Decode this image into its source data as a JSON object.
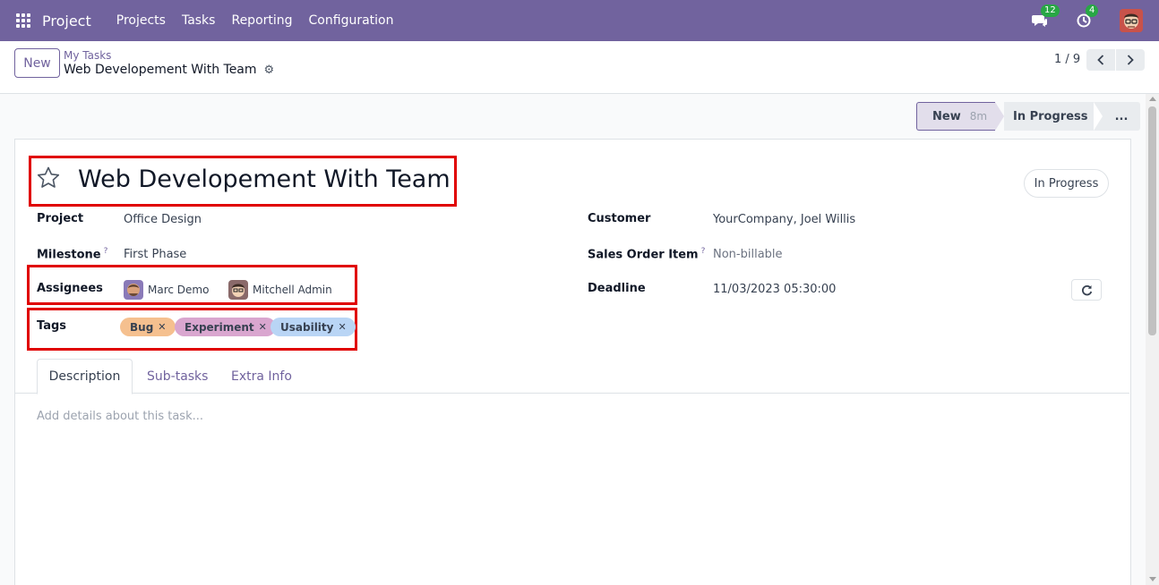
{
  "navbar": {
    "app_name": "Project",
    "menu": [
      "Projects",
      "Tasks",
      "Reporting",
      "Configuration"
    ],
    "messages_count": "12",
    "activities_count": "4",
    "bg_color": "#71639e"
  },
  "control_panel": {
    "new_label": "New",
    "breadcrumb_parent": "My Tasks",
    "breadcrumb_current": "Web Developement With Team",
    "pager": "1 / 9"
  },
  "statusbar": {
    "stage_new": "New",
    "stage_new_duration": "8m",
    "stage_in_progress": "In Progress",
    "more": "..."
  },
  "task": {
    "title": "Web Developement With Team",
    "state": "In Progress",
    "fields": {
      "project_label": "Project",
      "project_value": "Office Design",
      "milestone_label": "Milestone",
      "milestone_value": "First Phase",
      "assignees_label": "Assignees",
      "assignees": [
        "Marc Demo",
        "Mitchell Admin"
      ],
      "tags_label": "Tags",
      "tags": [
        {
          "label": "Bug",
          "color": "#f5c08f"
        },
        {
          "label": "Experiment",
          "color": "#d9a6cf"
        },
        {
          "label": "Usability",
          "color": "#b9d5f5"
        }
      ],
      "customer_label": "Customer",
      "customer_value": "YourCompany, Joel Willis",
      "sales_order_item_label": "Sales Order Item",
      "sales_order_item_value": "Non-billable",
      "deadline_label": "Deadline",
      "deadline_value": "11/03/2023 05:30:00",
      "help_mark": "?"
    }
  },
  "tabs": [
    "Description",
    "Sub-tasks",
    "Extra Info"
  ],
  "description_placeholder": "Add details about this task..."
}
